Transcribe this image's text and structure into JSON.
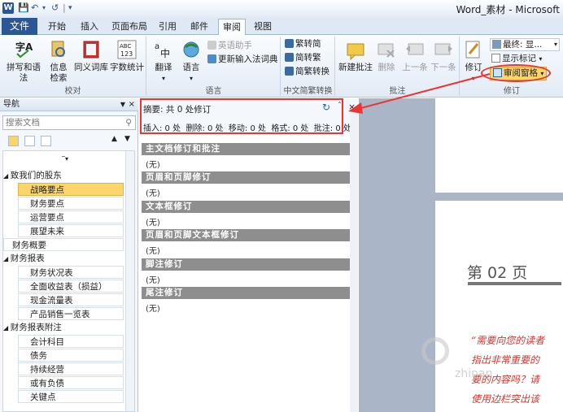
{
  "window": {
    "title": "Word_素材 - Microsoft",
    "app_icon": "W"
  },
  "tabs": [
    "文件",
    "开始",
    "插入",
    "页面布局",
    "引用",
    "邮件",
    "审阅",
    "视图"
  ],
  "ribbon": {
    "proofing": {
      "label": "校对",
      "spell": "拼写和语法",
      "info": "信息检索",
      "thesaurus": "同义词库",
      "count": "字数统计"
    },
    "language": {
      "label": "语言",
      "translate": "翻译",
      "lang": "语言",
      "en_assist": "英语助手",
      "update_ime": "更新输入法词典"
    },
    "chinese": {
      "label": "中文简繁转换",
      "to_trad": "繁转简",
      "to_simp": "简转繁",
      "convert": "简繁转换"
    },
    "comments": {
      "label": "批注",
      "new": "新建批注",
      "delete": "删除",
      "prev": "上一条",
      "next": "下一条"
    },
    "tracking": {
      "label": "修订",
      "track": "修订",
      "final_show": "最终: 显...",
      "show_markup": "显示标记",
      "review_pane": "审阅窗格"
    }
  },
  "nav": {
    "title": "导航",
    "search_placeholder": "搜索文档",
    "items": [
      {
        "label": "致我们的股东",
        "level": 1
      },
      {
        "label": "战略要点",
        "level": 2,
        "selected": true
      },
      {
        "label": "财务要点",
        "level": 2
      },
      {
        "label": "运营要点",
        "level": 2
      },
      {
        "label": "展望未来",
        "level": 2
      },
      {
        "label": "财务概要",
        "level": 1,
        "leaf": true
      },
      {
        "label": "财务报表",
        "level": 1
      },
      {
        "label": "财务状况表",
        "level": 2
      },
      {
        "label": "全面收益表（损益）",
        "level": 2
      },
      {
        "label": "现金流量表",
        "level": 2
      },
      {
        "label": "产品销售一览表",
        "level": 2
      },
      {
        "label": "财务报表附注",
        "level": 1
      },
      {
        "label": "会计科目",
        "level": 2
      },
      {
        "label": "债务",
        "level": 2
      },
      {
        "label": "持续经营",
        "level": 2
      },
      {
        "label": "或有负债",
        "level": 2
      },
      {
        "label": "关键点",
        "level": 2
      }
    ]
  },
  "review": {
    "summary": "摘要: 共 0 处修订",
    "detail": "插入: 0 处  删除: 0 处  移动: 0 处  格式: 0 处  批注: 0 处",
    "sections": [
      {
        "title": "主文档修订和批注",
        "value": "(无)"
      },
      {
        "title": "页眉和页脚修订",
        "value": "(无)"
      },
      {
        "title": "文本框修订",
        "value": "(无)"
      },
      {
        "title": "页眉和页脚文本框修订",
        "value": "(无)"
      },
      {
        "title": "脚注修订",
        "value": "(无)"
      },
      {
        "title": "尾注修订",
        "value": "(无)"
      }
    ]
  },
  "document": {
    "page_label": "第 02 页",
    "quote": [
      "“需要向您的读者",
      "指出非常重要的",
      "要的内容吗？请",
      "使用边栏突出该"
    ],
    "watermark": "zhinan"
  },
  "colors": {
    "accent_red": "#e33333",
    "file_tab": "#2b5797",
    "highlight": "#fcd66d",
    "quote_red": "#e0312b"
  }
}
